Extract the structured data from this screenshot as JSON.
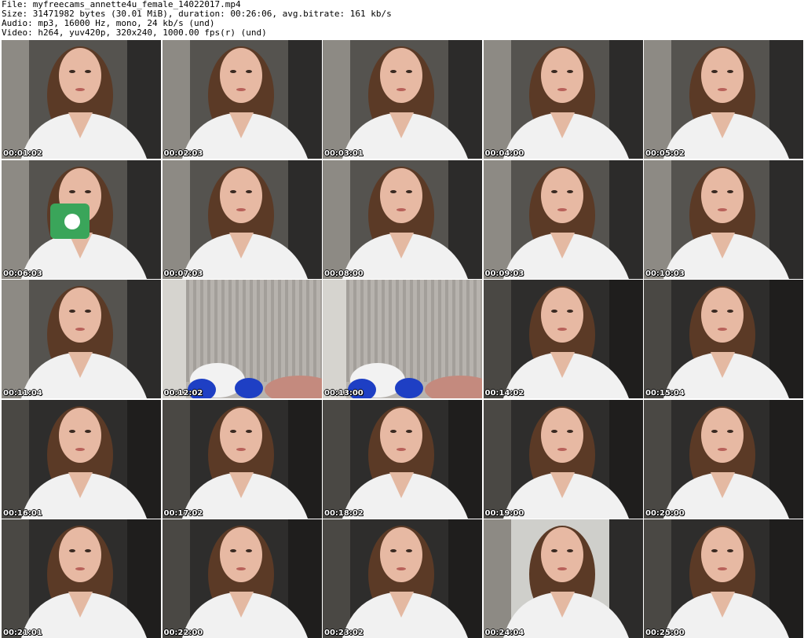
{
  "header": {
    "file_line": "File: myfreecams_annette4u_female_14022017.mp4",
    "size_line": "Size: 31471982 bytes (30.01 MiB), duration: 00:26:06, avg.bitrate: 161 kb/s",
    "audio_line": "Audio: mp3, 16000 Hz, mono, 24 kb/s (und)",
    "video_line": "Video: h264, yuv420p, 320x240, 1000.00 fps(r) (und)"
  },
  "thumbnails": [
    {
      "time": "00:01:02",
      "scene": "person"
    },
    {
      "time": "00:02:03",
      "scene": "person"
    },
    {
      "time": "00:03:01",
      "scene": "person"
    },
    {
      "time": "00:04:00",
      "scene": "person"
    },
    {
      "time": "00:05:02",
      "scene": "person"
    },
    {
      "time": "00:06:03",
      "scene": "person-mug"
    },
    {
      "time": "00:07:03",
      "scene": "person"
    },
    {
      "time": "00:08:00",
      "scene": "person"
    },
    {
      "time": "00:09:03",
      "scene": "person"
    },
    {
      "time": "00:10:03",
      "scene": "person"
    },
    {
      "time": "00:11:04",
      "scene": "person"
    },
    {
      "time": "00:12:02",
      "scene": "curtain-toy"
    },
    {
      "time": "00:13:00",
      "scene": "curtain-toy"
    },
    {
      "time": "00:14:02",
      "scene": "person-dark"
    },
    {
      "time": "00:15:04",
      "scene": "person-dark"
    },
    {
      "time": "00:16:01",
      "scene": "person-dark"
    },
    {
      "time": "00:17:02",
      "scene": "person-dark"
    },
    {
      "time": "00:18:02",
      "scene": "person-dark"
    },
    {
      "time": "00:19:00",
      "scene": "person-dark"
    },
    {
      "time": "00:20:00",
      "scene": "person-dark"
    },
    {
      "time": "00:21:01",
      "scene": "person-dark"
    },
    {
      "time": "00:22:00",
      "scene": "person-dark"
    },
    {
      "time": "00:23:02",
      "scene": "person-dark"
    },
    {
      "time": "00:24:04",
      "scene": "person-light"
    },
    {
      "time": "00:25:00",
      "scene": "person-dark"
    }
  ]
}
